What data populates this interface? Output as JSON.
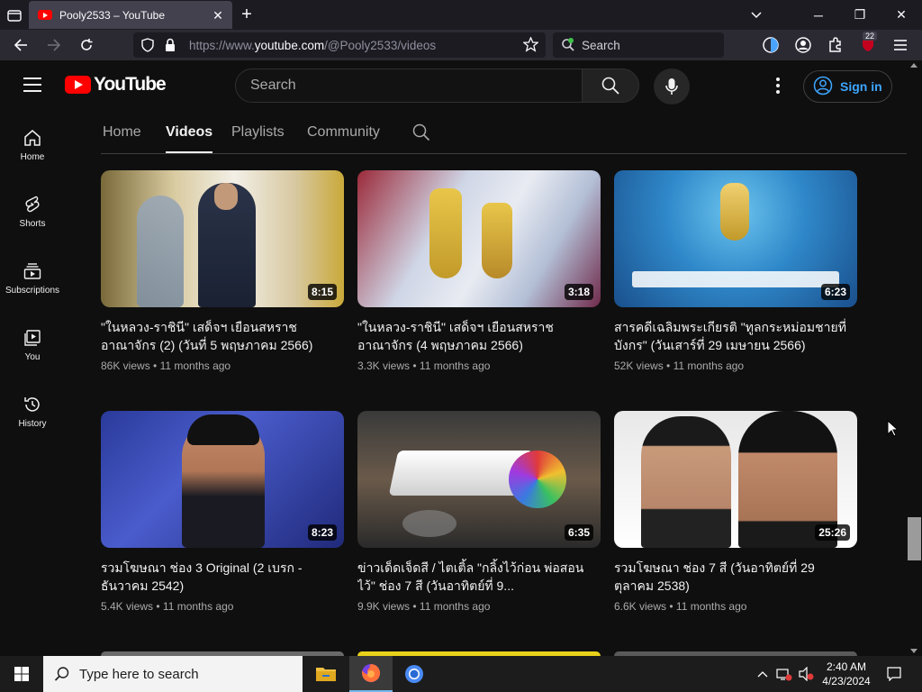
{
  "browser": {
    "tab_title": "Pooly2533 – YouTube",
    "url_prefix": "https://www.",
    "url_domain": "youtube.com",
    "url_path": "/@Pooly2533/videos",
    "search_placeholder": "Search",
    "extensions_badge": "22"
  },
  "youtube": {
    "logo_text": "YouTube",
    "search_placeholder": "Search",
    "sign_in_label": "Sign in",
    "sidebar": [
      {
        "label": "Home",
        "icon": "home-icon"
      },
      {
        "label": "Shorts",
        "icon": "shorts-icon"
      },
      {
        "label": "Subscriptions",
        "icon": "subscriptions-icon"
      },
      {
        "label": "You",
        "icon": "you-icon"
      },
      {
        "label": "History",
        "icon": "history-icon"
      }
    ],
    "channel_tabs": [
      "Home",
      "Videos",
      "Playlists",
      "Community"
    ],
    "active_tab": "Videos",
    "videos": [
      {
        "title": "\"ในหลวง-ราชินี\" เสด็จฯ เยือนสหราชอาณาจักร (2) (วันที่ 5 พฤษภาคม 2566)",
        "views": "86K views",
        "age": "11 months ago",
        "duration": "8:15"
      },
      {
        "title": "\"ในหลวง-ราชินี\" เสด็จฯ เยือนสหราชอาณาจักร (4 พฤษภาคม 2566)",
        "views": "3.3K views",
        "age": "11 months ago",
        "duration": "3:18"
      },
      {
        "title": "สารคดีเฉลิมพระเกียรติ \"ทูลกระหม่อมชายที่บังกร\" (วันเสาร์ที่ 29 เมษายน 2566)",
        "views": "52K views",
        "age": "11 months ago",
        "duration": "6:23"
      },
      {
        "title": "รวมโฆษณา ช่อง 3 Original (2 เบรก - ธันวาคม 2542)",
        "views": "5.4K views",
        "age": "11 months ago",
        "duration": "8:23"
      },
      {
        "title": "ข่าวเด็ดเจ็ดสี / ไตเติ้ล \"กลิ้งไว้ก่อน พ่อสอนไว้\" ช่อง 7 สี (วันอาทิตย์ที่ 9...",
        "views": "9.9K views",
        "age": "11 months ago",
        "duration": "6:35"
      },
      {
        "title": "รวมโฆษณา ช่อง 7 สี (วันอาทิตย์ที่ 29 ตุลาคม 2538)",
        "views": "6.6K views",
        "age": "11 months ago",
        "duration": "25:26"
      }
    ],
    "meta_separator": "•"
  },
  "taskbar": {
    "search_placeholder": "Type here to search",
    "time": "2:40 AM",
    "date": "4/23/2024"
  }
}
